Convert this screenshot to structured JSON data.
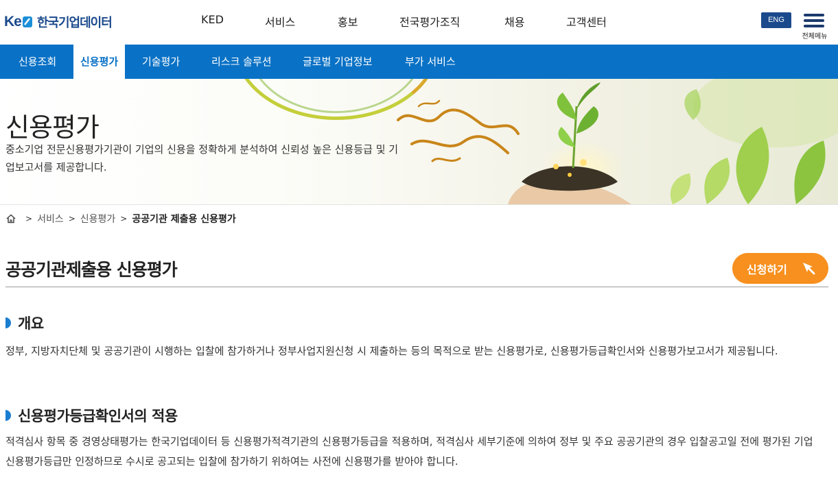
{
  "header": {
    "logo_text": "한국기업데이터",
    "logo_mark": "KED",
    "gnb": [
      "KED",
      "서비스",
      "홍보",
      "전국평가조직",
      "채용",
      "고객센터"
    ],
    "eng_label": "ENG",
    "menu_label": "전체메뉴"
  },
  "subnav": {
    "items": [
      "신용조회",
      "신용평가",
      "기술평가",
      "리스크 솔루션",
      "글로벌 기업정보",
      "부가 서비스"
    ],
    "active_index": 1
  },
  "banner": {
    "title": "신용평가",
    "description": "중소기업 전문신용평가기관이 기업의 신용을 정확하게 분석하여 신뢰성 높은 신용등급 및 기업보고서를 제공합니다."
  },
  "breadcrumb": {
    "items": [
      "서비스",
      "신용평가"
    ],
    "current": "공공기관 제출용 신용평가"
  },
  "page": {
    "title": "공공기관제출용 신용평가",
    "apply_label": "신청하기"
  },
  "sections": [
    {
      "heading": "개요",
      "text": "정부, 지방자치단체 및 공공기관이 시행하는 입찰에 참가하거나 정부사업지원신청 시 제출하는 등의 목적으로 받는 신용평가로, 신용평가등급확인서와 신용평가보고서가 제공됩니다."
    },
    {
      "heading": "신용평가등급확인서의 적용",
      "text": "적격심사 항목 중 경영상태평가는 한국기업데이터 등 신용평가적격기관의 신용평가등급을 적용하며, 적격심사 세부기준에 의하여 정부 및 주요 공공기관의 경우 입찰공고일 전에 평가된 기업신용평가등급만 인정하므로 수시로 공고되는 입찰에 참가하기 위하여는 사전에 신용평가를 받아야 합니다."
    }
  ],
  "colors": {
    "brand_blue": "#1b4a8c",
    "subnav_blue": "#0a72c6",
    "apply_orange": "#f7901e"
  }
}
